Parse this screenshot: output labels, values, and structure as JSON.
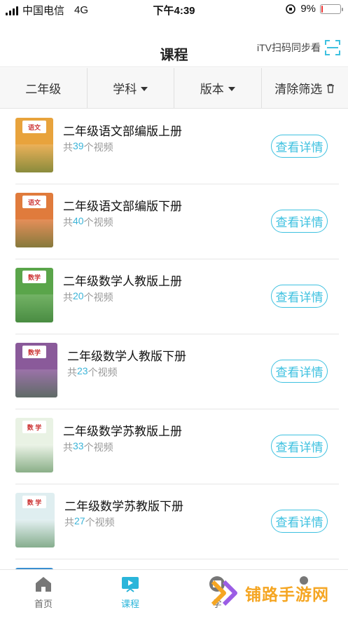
{
  "status_bar": {
    "carrier": "中国电信",
    "network": "4G",
    "time": "下午4:39",
    "battery": "9%",
    "battery_level": 0.09
  },
  "header": {
    "title": "课程",
    "scan_label": "iTV扫码同步看"
  },
  "filters": {
    "grade": "二年级",
    "subject": "学科",
    "edition": "版本",
    "clear": "清除筛选"
  },
  "courses": [
    {
      "name": "二年级语文部编版上册",
      "count_prefix": "共",
      "count": "39",
      "count_suffix": "个视频",
      "button": "查看详情",
      "cover_label": "语文",
      "cover_color": "#e8a33c"
    },
    {
      "name": "二年级语文部编版下册",
      "count_prefix": "共",
      "count": "40",
      "count_suffix": "个视频",
      "button": "查看详情",
      "cover_label": "语文",
      "cover_color": "#e07b3c"
    },
    {
      "name": "二年级数学人教版上册",
      "count_prefix": "共",
      "count": "20",
      "count_suffix": "个视频",
      "button": "查看详情",
      "cover_label": "数学",
      "cover_color": "#5aa54a"
    },
    {
      "name": "二年级数学人教版下册",
      "count_prefix": "共",
      "count": "23",
      "count_suffix": "个视频",
      "button": "查看详情",
      "cover_label": "数学",
      "cover_color": "#8a5a9a"
    },
    {
      "name": "二年级数学苏教版上册",
      "count_prefix": "共",
      "count": "33",
      "count_suffix": "个视频",
      "button": "查看详情",
      "cover_label": "数 学",
      "cover_color": "#e9f2e4"
    },
    {
      "name": "二年级数学苏教版下册",
      "count_prefix": "共",
      "count": "27",
      "count_suffix": "个视频",
      "button": "查看详情",
      "cover_label": "数 学",
      "cover_color": "#dfeef0"
    }
  ],
  "tabs": {
    "home": "首页",
    "course": "课程",
    "study": "学",
    "mine": ""
  },
  "watermark": "铺路手游网",
  "colors": {
    "accent": "#3ec1e0",
    "count_number": "#3cb4d8",
    "watermark": "#f5a623"
  }
}
